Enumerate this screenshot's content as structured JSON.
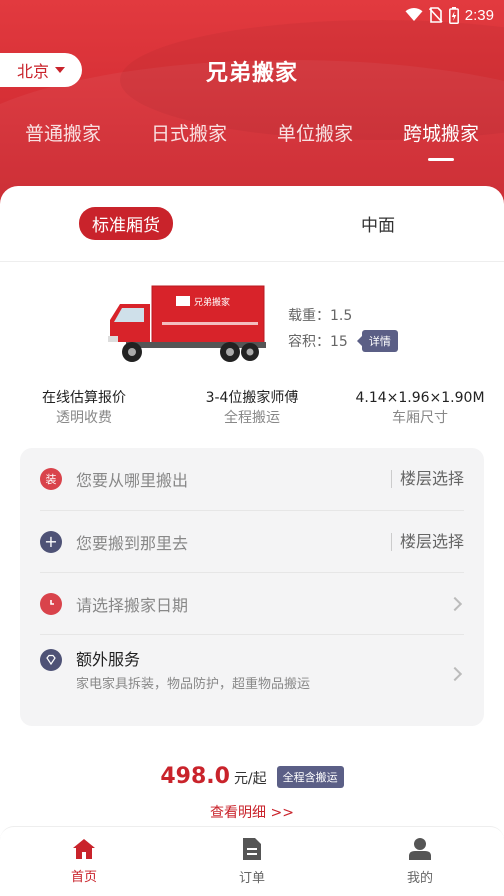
{
  "status_bar": {
    "time": "2:39",
    "icons": [
      "wifi-icon",
      "no-sim-icon",
      "battery-icon"
    ]
  },
  "header": {
    "city": "北京",
    "title": "兄弟搬家",
    "tabs": [
      {
        "label": "普通搬家",
        "active": false
      },
      {
        "label": "日式搬家",
        "active": false
      },
      {
        "label": "单位搬家",
        "active": false
      },
      {
        "label": "跨城搬家",
        "active": true
      }
    ]
  },
  "vehicle_tabs": [
    {
      "label": "标准厢货",
      "active": true
    },
    {
      "label": "中面",
      "active": false
    }
  ],
  "truck": {
    "brand_text": "兄弟搬家",
    "load_label": "载重：1.5",
    "volume_label": "容积：15",
    "detail_badge": "详情"
  },
  "features": [
    {
      "title": "在线估算报价",
      "subtitle": "透明收费"
    },
    {
      "title": "3-4位搬家师傅",
      "subtitle": "全程搬运"
    },
    {
      "title": "4.14×1.96×1.90M",
      "subtitle": "车厢尺寸"
    }
  ],
  "form": {
    "from_placeholder": "您要从哪里搬出",
    "from_icon_text": "装",
    "to_placeholder": "您要搬到那里去",
    "floor_label": "楼层选择",
    "date_placeholder": "请选择搬家日期",
    "extra_title": "额外服务",
    "extra_sub": "家电家具拆装，物品防护，超重物品搬运"
  },
  "price": {
    "amount": "498.0",
    "unit": "元/起",
    "badge": "全程含搬运",
    "view_detail": "查看明细 >>"
  },
  "bottom_nav": [
    {
      "label": "首页",
      "icon": "home-icon",
      "active": true
    },
    {
      "label": "订单",
      "icon": "order-icon",
      "active": false
    },
    {
      "label": "我的",
      "icon": "profile-icon",
      "active": false
    }
  ],
  "colors": {
    "brand_red": "#c9232b",
    "badge": "#5b5f86"
  }
}
